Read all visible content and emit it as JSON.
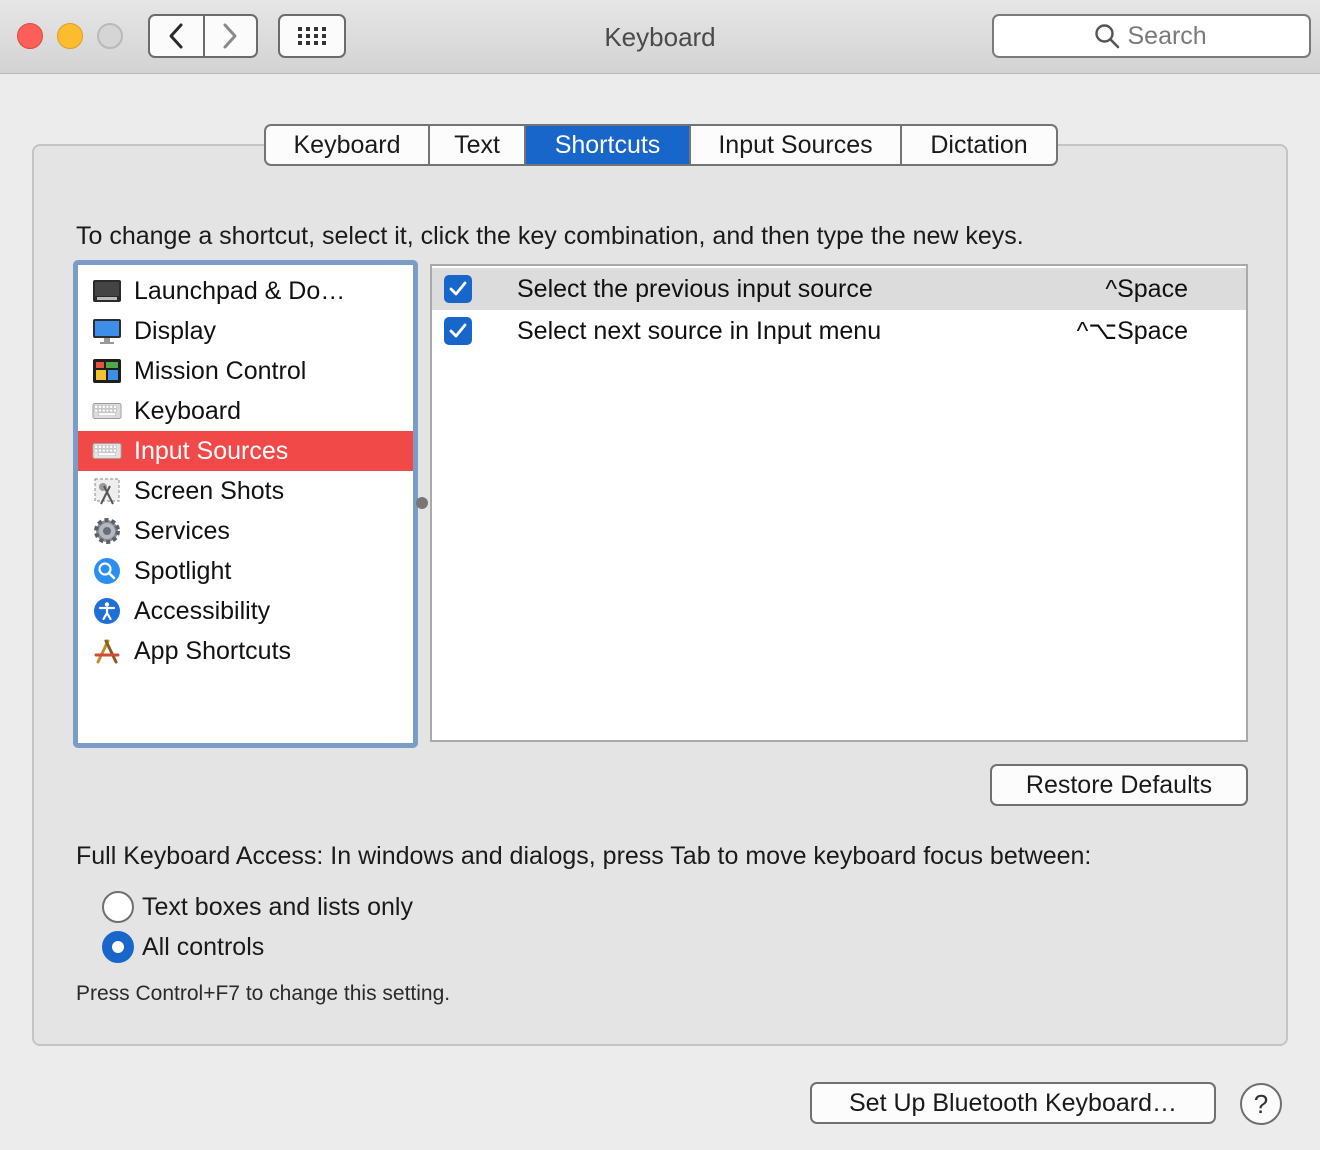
{
  "window": {
    "title": "Keyboard",
    "search_placeholder": "Search"
  },
  "tabs": [
    {
      "label": "Keyboard",
      "active": false
    },
    {
      "label": "Text",
      "active": false
    },
    {
      "label": "Shortcuts",
      "active": true
    },
    {
      "label": "Input Sources",
      "active": false
    },
    {
      "label": "Dictation",
      "active": false
    }
  ],
  "hint": "To change a shortcut, select it, click the key combination, and then type the new keys.",
  "categories": [
    {
      "label": "Launchpad & Do…",
      "icon": "launchpad-icon",
      "selected": false
    },
    {
      "label": "Display",
      "icon": "display-icon",
      "selected": false
    },
    {
      "label": "Mission Control",
      "icon": "mission-control-icon",
      "selected": false
    },
    {
      "label": "Keyboard",
      "icon": "keyboard-icon",
      "selected": false
    },
    {
      "label": "Input Sources",
      "icon": "keyboard-icon",
      "selected": true
    },
    {
      "label": "Screen Shots",
      "icon": "screenshot-icon",
      "selected": false
    },
    {
      "label": "Services",
      "icon": "gear-icon",
      "selected": false
    },
    {
      "label": "Spotlight",
      "icon": "spotlight-icon",
      "selected": false
    },
    {
      "label": "Accessibility",
      "icon": "accessibility-icon",
      "selected": false
    },
    {
      "label": "App Shortcuts",
      "icon": "app-store-icon",
      "selected": false
    }
  ],
  "shortcuts": [
    {
      "checked": true,
      "name": "Select the previous input source",
      "keys": "^Space",
      "selected": true
    },
    {
      "checked": true,
      "name": "Select next source in Input menu",
      "keys": "^⌥Space",
      "selected": false
    }
  ],
  "buttons": {
    "restore_defaults": "Restore Defaults",
    "bluetooth_setup": "Set Up Bluetooth Keyboard…",
    "help": "?"
  },
  "full_keyboard_access": {
    "label": "Full Keyboard Access: In windows and dialogs, press Tab to move keyboard focus between:",
    "options": [
      {
        "label": "Text boxes and lists only",
        "selected": false
      },
      {
        "label": "All controls",
        "selected": true
      }
    ],
    "note": "Press Control+F7 to change this setting."
  },
  "colors": {
    "accent": "#1966cb",
    "selection_red": "#f14948",
    "close": "#fc5f57",
    "minimize": "#fdbc2e"
  }
}
